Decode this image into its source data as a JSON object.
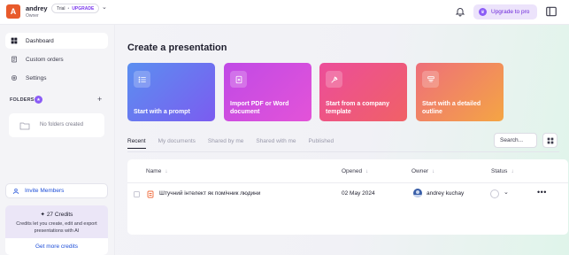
{
  "header": {
    "avatar_letter": "A",
    "user_name": "andrey",
    "user_role": "Owner",
    "plan_label": "Trial",
    "plan_separator": "•",
    "plan_upgrade": "UPGRADE",
    "upgrade_button": "Upgrade to pro",
    "icons": [
      "chevron-down-icon",
      "bell-icon",
      "crown-icon",
      "layout-icon"
    ]
  },
  "sidebar": {
    "nav": [
      {
        "label": "Dashboard",
        "icon": "dashboard-icon",
        "active": true
      },
      {
        "label": "Custom orders",
        "icon": "document-icon",
        "active": false
      },
      {
        "label": "Settings",
        "icon": "gear-icon",
        "active": false
      }
    ],
    "folders": {
      "title": "FOLDERS",
      "badge": "★",
      "add": "+",
      "empty_text": "No folders created"
    },
    "invite_label": "Invite Members",
    "credits": {
      "title": "27 Credits",
      "description": "Credits let you create, edit and export presentations with AI",
      "button": "Get more credits"
    }
  },
  "main": {
    "title": "Create a presentation",
    "cards": [
      {
        "label": "Start with a prompt",
        "icon": "list-icon"
      },
      {
        "label": "Import PDF or Word document",
        "icon": "upload-doc-icon"
      },
      {
        "label": "Start from a company template",
        "icon": "template-icon"
      },
      {
        "label": "Start with a detailed outline",
        "icon": "outline-icon"
      }
    ],
    "tabs": [
      "Recent",
      "My documents",
      "Shared by me",
      "Shared with me",
      "Published"
    ],
    "active_tab": "Recent",
    "search_placeholder": "Search...",
    "table": {
      "columns": [
        "Name",
        "Opened",
        "Owner",
        "Status"
      ],
      "sort_arrow": "↓",
      "rows": [
        {
          "name": "Штучний інтелект як помічник людини",
          "opened": "02 May 2024",
          "owner": "andrey kuchay",
          "status_chevron": "⌄",
          "more": "•••"
        }
      ]
    }
  },
  "colors": {
    "accent_purple": "#7c3aed",
    "link_blue": "#1d4ed8",
    "avatar_orange": "#e85a2b"
  }
}
